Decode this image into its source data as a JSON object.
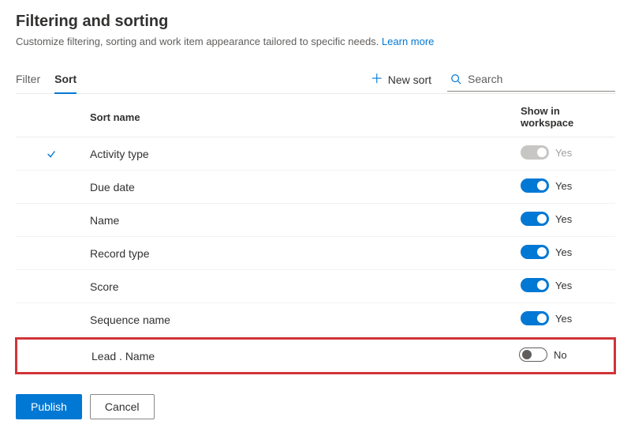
{
  "header": {
    "title": "Filtering and sorting",
    "subtitle": "Customize filtering, sorting and work item appearance tailored to specific needs.",
    "learn_more": "Learn more"
  },
  "tabs": {
    "filter": "Filter",
    "sort": "Sort"
  },
  "toolbar": {
    "new_sort": "New sort",
    "search_placeholder": "Search"
  },
  "columns": {
    "sort_name": "Sort name",
    "show_in_workspace": "Show in workspace"
  },
  "rows": [
    {
      "name": "Activity type",
      "checked": true,
      "toggle_state": "disabled",
      "toggle_label": "Yes",
      "highlighted": false
    },
    {
      "name": "Due date",
      "checked": false,
      "toggle_state": "on",
      "toggle_label": "Yes",
      "highlighted": false
    },
    {
      "name": "Name",
      "checked": false,
      "toggle_state": "on",
      "toggle_label": "Yes",
      "highlighted": false
    },
    {
      "name": "Record type",
      "checked": false,
      "toggle_state": "on",
      "toggle_label": "Yes",
      "highlighted": false
    },
    {
      "name": "Score",
      "checked": false,
      "toggle_state": "on",
      "toggle_label": "Yes",
      "highlighted": false
    },
    {
      "name": "Sequence name",
      "checked": false,
      "toggle_state": "on",
      "toggle_label": "Yes",
      "highlighted": false
    },
    {
      "name": "Lead . Name",
      "checked": false,
      "toggle_state": "off",
      "toggle_label": "No",
      "highlighted": true
    }
  ],
  "footer": {
    "publish": "Publish",
    "cancel": "Cancel"
  }
}
